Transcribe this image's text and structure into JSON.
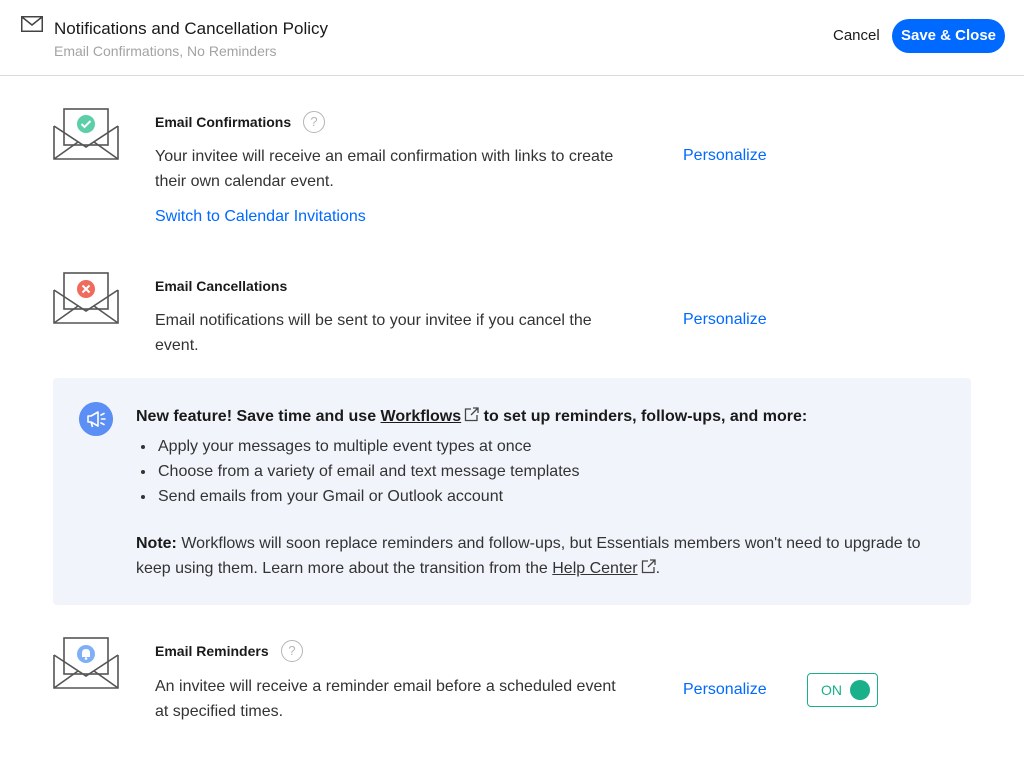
{
  "header": {
    "title": "Notifications and Cancellation Policy",
    "subtitle": "Email Confirmations, No Reminders",
    "cancel_label": "Cancel",
    "save_label": "Save & Close"
  },
  "sections": {
    "confirmations": {
      "title": "Email Confirmations",
      "help": "?",
      "desc_line1": "Your invitee will receive an email confirmation with links to create",
      "desc_line2": "their own calendar event.",
      "personalize": "Personalize",
      "switch_link": "Switch to Calendar Invitations",
      "icon": "check-icon",
      "icon_color": "#5ccfa7"
    },
    "cancellations": {
      "title": "Email Cancellations",
      "desc_line1": "Email notifications will be sent to your invitee if you cancel the",
      "desc_line2": "event.",
      "personalize": "Personalize",
      "icon": "x-icon",
      "icon_color": "#ef6b5b"
    },
    "reminders": {
      "title": "Email Reminders",
      "help": "?",
      "desc_line1": "An invitee will receive a reminder email before a scheduled event",
      "desc_line2": "at specified times.",
      "personalize": "Personalize",
      "toggle_label": "ON",
      "toggle_on": true,
      "icon": "bell-icon",
      "icon_color": "#7fb0f7"
    }
  },
  "feature": {
    "headline_prefix": "New feature! Save time and use",
    "headline_link": "Workflows",
    "headline_suffix": "to set up reminders, follow-ups, and more:",
    "bullets": [
      "Apply your messages to multiple event types at once",
      "Choose from a variety of email and text message templates",
      "Send emails from your Gmail or Outlook account"
    ],
    "note_label": "Note:",
    "note_text_1": "Workflows will soon replace reminders and follow-ups, but Essentials members won't need to upgrade",
    "note_text_2": "to keep using them. Learn more about the transition from the",
    "note_link": "Help Center",
    "note_end": ".",
    "icon": "megaphone-icon"
  },
  "colors": {
    "accent": "#0069ff",
    "toggle_green": "#19b08a",
    "feature_bg": "#f1f5fb"
  }
}
